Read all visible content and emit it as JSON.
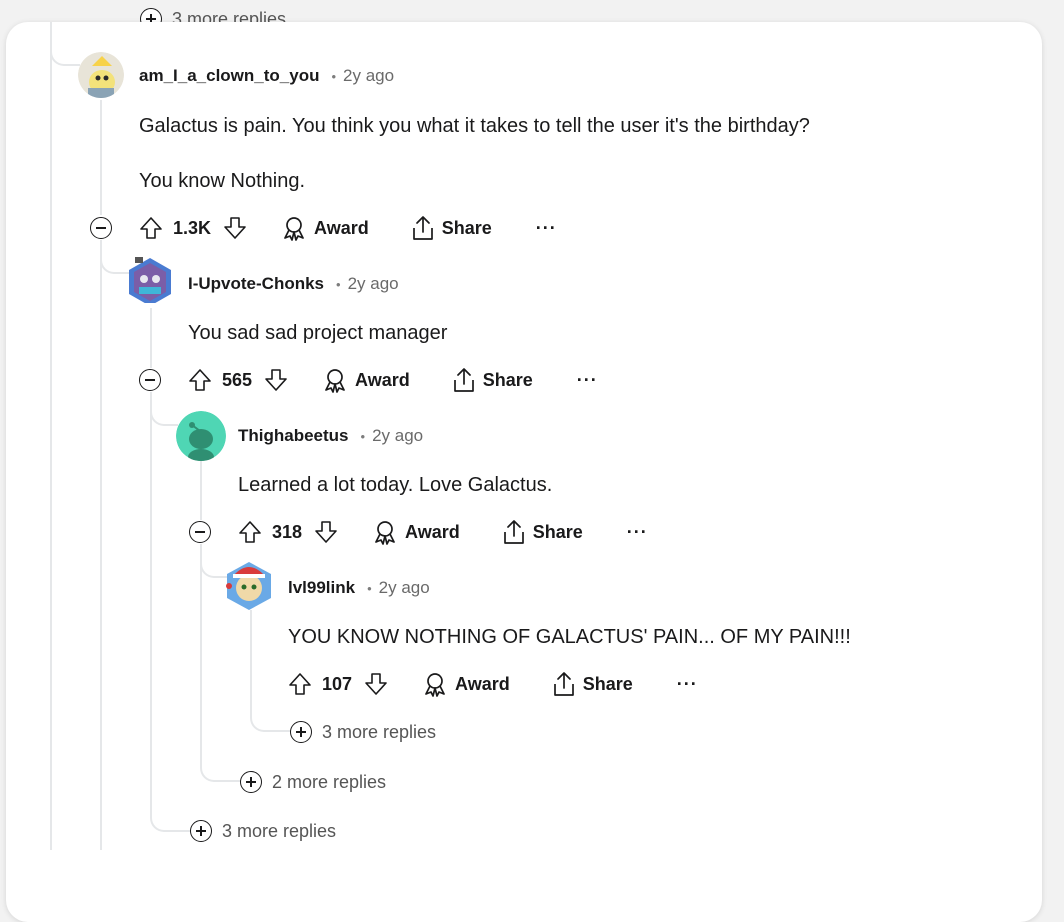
{
  "top_more": {
    "label": "3 more replies"
  },
  "comments": [
    {
      "author": "am_I_a_clown_to_you",
      "age": "2y ago",
      "lines": [
        "Galactus is pain. You think you what it takes to tell the user it's the birthday?",
        "You know Nothing."
      ],
      "votes": "1.3K",
      "award": "Award",
      "share": "Share"
    },
    {
      "author": "I-Upvote-Chonks",
      "age": "2y ago",
      "lines": [
        "You sad sad project manager"
      ],
      "votes": "565",
      "award": "Award",
      "share": "Share"
    },
    {
      "author": "Thighabeetus",
      "age": "2y ago",
      "lines": [
        "Learned a lot today. Love Galactus."
      ],
      "votes": "318",
      "award": "Award",
      "share": "Share"
    },
    {
      "author": "lvl99link",
      "age": "2y ago",
      "lines": [
        "YOU KNOW NOTHING OF GALACTUS' PAIN... OF MY PAIN!!!"
      ],
      "votes": "107",
      "award": "Award",
      "share": "Share"
    }
  ],
  "more_replies": [
    {
      "label": "3 more replies"
    },
    {
      "label": "2 more replies"
    },
    {
      "label": "3 more replies"
    }
  ],
  "separator": "•",
  "overflow": "···"
}
